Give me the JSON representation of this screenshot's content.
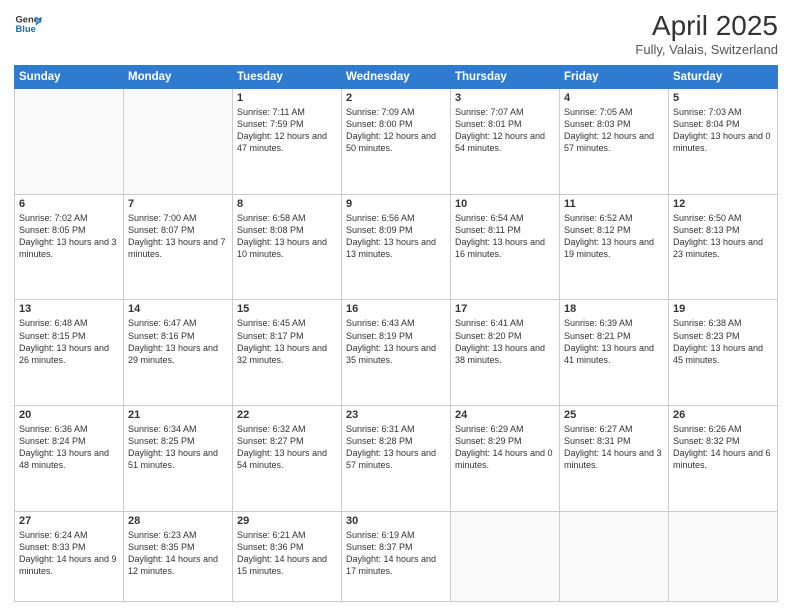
{
  "header": {
    "logo_general": "General",
    "logo_blue": "Blue",
    "title": "April 2025",
    "location": "Fully, Valais, Switzerland"
  },
  "weekdays": [
    "Sunday",
    "Monday",
    "Tuesday",
    "Wednesday",
    "Thursday",
    "Friday",
    "Saturday"
  ],
  "weeks": [
    [
      {
        "day": "",
        "info": ""
      },
      {
        "day": "",
        "info": ""
      },
      {
        "day": "1",
        "info": "Sunrise: 7:11 AM\nSunset: 7:59 PM\nDaylight: 12 hours and 47 minutes."
      },
      {
        "day": "2",
        "info": "Sunrise: 7:09 AM\nSunset: 8:00 PM\nDaylight: 12 hours and 50 minutes."
      },
      {
        "day": "3",
        "info": "Sunrise: 7:07 AM\nSunset: 8:01 PM\nDaylight: 12 hours and 54 minutes."
      },
      {
        "day": "4",
        "info": "Sunrise: 7:05 AM\nSunset: 8:03 PM\nDaylight: 12 hours and 57 minutes."
      },
      {
        "day": "5",
        "info": "Sunrise: 7:03 AM\nSunset: 8:04 PM\nDaylight: 13 hours and 0 minutes."
      }
    ],
    [
      {
        "day": "6",
        "info": "Sunrise: 7:02 AM\nSunset: 8:05 PM\nDaylight: 13 hours and 3 minutes."
      },
      {
        "day": "7",
        "info": "Sunrise: 7:00 AM\nSunset: 8:07 PM\nDaylight: 13 hours and 7 minutes."
      },
      {
        "day": "8",
        "info": "Sunrise: 6:58 AM\nSunset: 8:08 PM\nDaylight: 13 hours and 10 minutes."
      },
      {
        "day": "9",
        "info": "Sunrise: 6:56 AM\nSunset: 8:09 PM\nDaylight: 13 hours and 13 minutes."
      },
      {
        "day": "10",
        "info": "Sunrise: 6:54 AM\nSunset: 8:11 PM\nDaylight: 13 hours and 16 minutes."
      },
      {
        "day": "11",
        "info": "Sunrise: 6:52 AM\nSunset: 8:12 PM\nDaylight: 13 hours and 19 minutes."
      },
      {
        "day": "12",
        "info": "Sunrise: 6:50 AM\nSunset: 8:13 PM\nDaylight: 13 hours and 23 minutes."
      }
    ],
    [
      {
        "day": "13",
        "info": "Sunrise: 6:48 AM\nSunset: 8:15 PM\nDaylight: 13 hours and 26 minutes."
      },
      {
        "day": "14",
        "info": "Sunrise: 6:47 AM\nSunset: 8:16 PM\nDaylight: 13 hours and 29 minutes."
      },
      {
        "day": "15",
        "info": "Sunrise: 6:45 AM\nSunset: 8:17 PM\nDaylight: 13 hours and 32 minutes."
      },
      {
        "day": "16",
        "info": "Sunrise: 6:43 AM\nSunset: 8:19 PM\nDaylight: 13 hours and 35 minutes."
      },
      {
        "day": "17",
        "info": "Sunrise: 6:41 AM\nSunset: 8:20 PM\nDaylight: 13 hours and 38 minutes."
      },
      {
        "day": "18",
        "info": "Sunrise: 6:39 AM\nSunset: 8:21 PM\nDaylight: 13 hours and 41 minutes."
      },
      {
        "day": "19",
        "info": "Sunrise: 6:38 AM\nSunset: 8:23 PM\nDaylight: 13 hours and 45 minutes."
      }
    ],
    [
      {
        "day": "20",
        "info": "Sunrise: 6:36 AM\nSunset: 8:24 PM\nDaylight: 13 hours and 48 minutes."
      },
      {
        "day": "21",
        "info": "Sunrise: 6:34 AM\nSunset: 8:25 PM\nDaylight: 13 hours and 51 minutes."
      },
      {
        "day": "22",
        "info": "Sunrise: 6:32 AM\nSunset: 8:27 PM\nDaylight: 13 hours and 54 minutes."
      },
      {
        "day": "23",
        "info": "Sunrise: 6:31 AM\nSunset: 8:28 PM\nDaylight: 13 hours and 57 minutes."
      },
      {
        "day": "24",
        "info": "Sunrise: 6:29 AM\nSunset: 8:29 PM\nDaylight: 14 hours and 0 minutes."
      },
      {
        "day": "25",
        "info": "Sunrise: 6:27 AM\nSunset: 8:31 PM\nDaylight: 14 hours and 3 minutes."
      },
      {
        "day": "26",
        "info": "Sunrise: 6:26 AM\nSunset: 8:32 PM\nDaylight: 14 hours and 6 minutes."
      }
    ],
    [
      {
        "day": "27",
        "info": "Sunrise: 6:24 AM\nSunset: 8:33 PM\nDaylight: 14 hours and 9 minutes."
      },
      {
        "day": "28",
        "info": "Sunrise: 6:23 AM\nSunset: 8:35 PM\nDaylight: 14 hours and 12 minutes."
      },
      {
        "day": "29",
        "info": "Sunrise: 6:21 AM\nSunset: 8:36 PM\nDaylight: 14 hours and 15 minutes."
      },
      {
        "day": "30",
        "info": "Sunrise: 6:19 AM\nSunset: 8:37 PM\nDaylight: 14 hours and 17 minutes."
      },
      {
        "day": "",
        "info": ""
      },
      {
        "day": "",
        "info": ""
      },
      {
        "day": "",
        "info": ""
      }
    ]
  ]
}
